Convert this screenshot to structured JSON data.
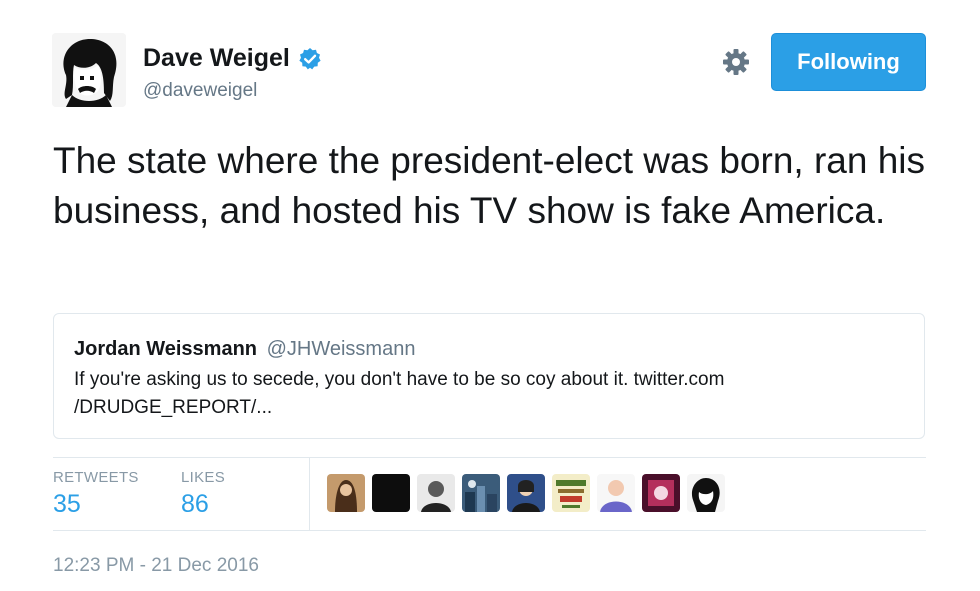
{
  "author": {
    "name": "Dave Weigel",
    "handle": "@daveweigel",
    "verified": true
  },
  "follow_button": {
    "label": "Following"
  },
  "tweet": {
    "text": "The state where the president-elect was born, ran his business, and hosted his TV show is fake America."
  },
  "quote": {
    "name": "Jordan Weissmann",
    "handle": "@JHWeissmann",
    "text": "If you're asking us to secede, you don't have to be so coy about it. twitter.com /DRUDGE_REPORT/..."
  },
  "stats": {
    "retweets_label": "RETWEETS",
    "retweets_count": "35",
    "likes_label": "LIKES",
    "likes_count": "86"
  },
  "timestamp": "12:23 PM - 21 Dec 2016",
  "colors": {
    "accent": "#2b9fe6",
    "muted": "#657786",
    "border": "#e1e8ed"
  },
  "icons": {
    "verified": "verified-badge-icon",
    "settings": "gear-icon"
  }
}
